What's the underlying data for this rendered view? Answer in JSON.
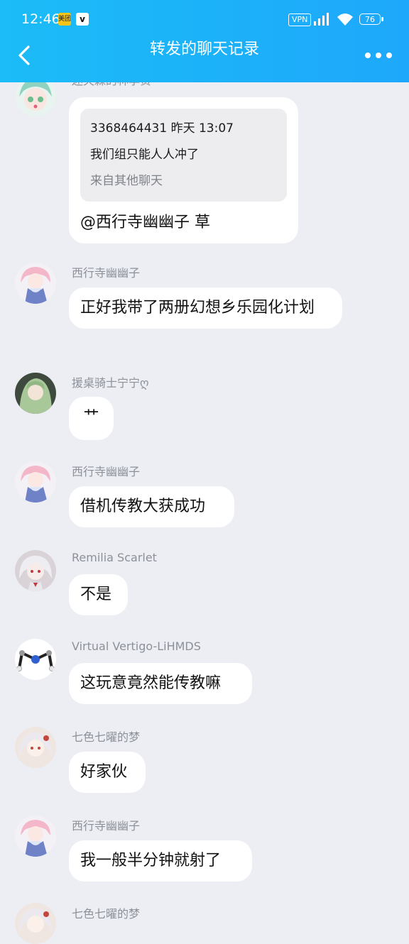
{
  "status": {
    "time": "12:46",
    "badge1": "美团",
    "badge2": "v",
    "vpn": "VPN",
    "battery": "76"
  },
  "nav": {
    "title": "转发的聊天记录"
  },
  "messages": [
    {
      "sender": "迷失森的林李贤",
      "quote": {
        "header": "3368464431 昨天 13:07",
        "text": "我们组只能人人冲了",
        "source": "来自其他聊天"
      },
      "text": "@西行寺幽幽子 草"
    },
    {
      "sender": "西行寺幽幽子",
      "text": "正好我带了两册幻想乡乐园化计划"
    },
    {
      "sender": "援桌骑士宁宁ღ",
      "text": "艹"
    },
    {
      "sender": "西行寺幽幽子",
      "text": "借机传教大获成功"
    },
    {
      "sender": "Remilia Scarlet",
      "text": "不是"
    },
    {
      "sender": "Virtual Vertigo-LiHMDS",
      "text": "这玩意竟然能传教嘛"
    },
    {
      "sender": "七色七曜的梦",
      "text": "好家伙"
    },
    {
      "sender": "西行寺幽幽子",
      "text": "我一般半分钟就射了"
    },
    {
      "sender": "七色七曜的梦",
      "text": ""
    }
  ]
}
